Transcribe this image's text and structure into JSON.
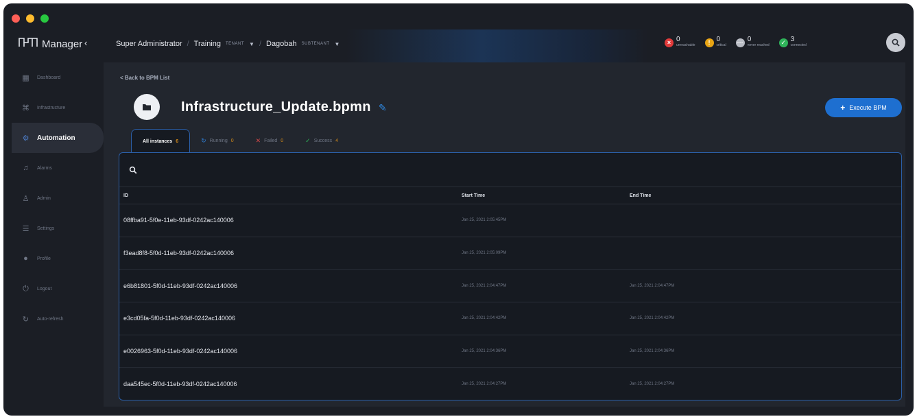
{
  "app": {
    "title": "Manager",
    "logo_text": "MSA"
  },
  "breadcrumb": {
    "role": "Super Administrator",
    "tenant": "Training",
    "tenant_tag": "TENANT",
    "subtenant": "Dagobah",
    "subtenant_tag": "SUBTENANT"
  },
  "statuses": [
    {
      "count": "0",
      "label": "unreachable",
      "color": "#e23b3b",
      "icon": "x-circle-icon"
    },
    {
      "count": "0",
      "label": "critical",
      "color": "#e9a514",
      "icon": "warning-circle-icon"
    },
    {
      "count": "0",
      "label": "never reached",
      "color": "#b9bcc4",
      "icon": "dots-circle-icon"
    },
    {
      "count": "3",
      "label": "connected",
      "color": "#2fb45a",
      "icon": "check-circle-icon"
    }
  ],
  "sidebar": {
    "items": [
      {
        "label": "Dashboard",
        "icon": "dashboard-icon"
      },
      {
        "label": "Infrastructure",
        "icon": "infrastructure-icon"
      },
      {
        "label": "Automation",
        "icon": "gear-icon",
        "active": true
      },
      {
        "label": "Alarms",
        "icon": "bell-icon"
      },
      {
        "label": "Admin",
        "icon": "admin-icon"
      },
      {
        "label": "Settings",
        "icon": "sliders-icon"
      },
      {
        "label": "Profile",
        "icon": "profile-icon"
      },
      {
        "label": "Logout",
        "icon": "power-icon"
      },
      {
        "label": "Auto-refresh",
        "icon": "refresh-icon"
      }
    ]
  },
  "page": {
    "back_label": "< Back to BPM List",
    "title": "Infrastructure_Update.bpmn",
    "execute_label": "Execute BPM"
  },
  "tabs": [
    {
      "label": "All instances",
      "count": "6",
      "active": true
    },
    {
      "label": "Running",
      "count": "0"
    },
    {
      "label": "Failed",
      "count": "0"
    },
    {
      "label": "Success",
      "count": "4"
    }
  ],
  "table": {
    "columns": [
      "ID",
      "Start Time",
      "End Time"
    ],
    "rows": [
      {
        "id": "08ffba91-5f0e-11eb-93df-0242ac140006",
        "start": "Jan 25, 2021 2:05:45PM",
        "end": ""
      },
      {
        "id": "f3ead8f8-5f0d-11eb-93df-0242ac140006",
        "start": "Jan 25, 2021 2:05:09PM",
        "end": ""
      },
      {
        "id": "e6b81801-5f0d-11eb-93df-0242ac140006",
        "start": "Jan 25, 2021 2:04:47PM",
        "end": "Jan 25, 2021 2:04:47PM"
      },
      {
        "id": "e3cd05fa-5f0d-11eb-93df-0242ac140006",
        "start": "Jan 25, 2021 2:04:42PM",
        "end": "Jan 25, 2021 2:04:42PM"
      },
      {
        "id": "e0026963-5f0d-11eb-93df-0242ac140006",
        "start": "Jan 25, 2021 2:04:36PM",
        "end": "Jan 25, 2021 2:04:36PM"
      },
      {
        "id": "daa545ec-5f0d-11eb-93df-0242ac140006",
        "start": "Jan 25, 2021 2:04:27PM",
        "end": "Jan 25, 2021 2:04:27PM"
      }
    ]
  }
}
